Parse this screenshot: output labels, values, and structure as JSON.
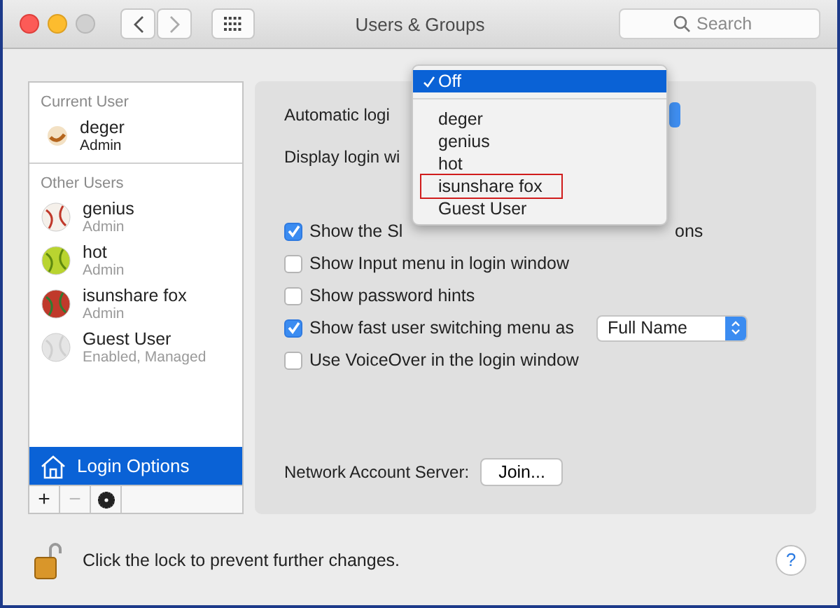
{
  "window": {
    "title": "Users & Groups",
    "search": {
      "placeholder": "Search"
    }
  },
  "sidebar": {
    "current_header": "Current User",
    "current_user": {
      "name": "deger",
      "role": "Admin"
    },
    "other_header": "Other Users",
    "other_users": [
      {
        "name": "genius",
        "role": "Admin"
      },
      {
        "name": "hot",
        "role": "Admin"
      },
      {
        "name": "isunshare fox",
        "role": "Admin"
      },
      {
        "name": "Guest User",
        "role": "Enabled, Managed"
      }
    ],
    "login_options": {
      "label": "Login Options",
      "selected": true
    },
    "toolbar": [
      "+",
      "−"
    ]
  },
  "panel": {
    "automatic_login_label": "Automatic logi",
    "display_login_label": "Display login wi",
    "options": [
      {
        "label": "Show the Sl",
        "tail": "ons",
        "checked": true
      },
      {
        "label": "Show Input menu in login window",
        "checked": false
      },
      {
        "label": "Show password hints",
        "checked": false
      },
      {
        "label": "Show fast user switching menu as",
        "checked": true,
        "popup": "Full Name"
      },
      {
        "label": "Use VoiceOver in the login window",
        "checked": false
      }
    ],
    "network_label": "Network Account Server:",
    "join_button": "Join..."
  },
  "menu": {
    "items": [
      {
        "label": "Off",
        "checked": true,
        "selected": true,
        "boxed": false
      },
      {
        "label": "deger",
        "checked": false,
        "selected": false,
        "boxed": false
      },
      {
        "label": "genius",
        "checked": false,
        "selected": false,
        "boxed": false
      },
      {
        "label": "hot",
        "checked": false,
        "selected": false,
        "boxed": false
      },
      {
        "label": "isunshare fox",
        "checked": false,
        "selected": false,
        "boxed": true
      },
      {
        "label": "Guest User",
        "checked": false,
        "selected": false,
        "boxed": false
      }
    ]
  },
  "footer": {
    "lock_text": "Click the lock to prevent further changes.",
    "help": "?"
  }
}
